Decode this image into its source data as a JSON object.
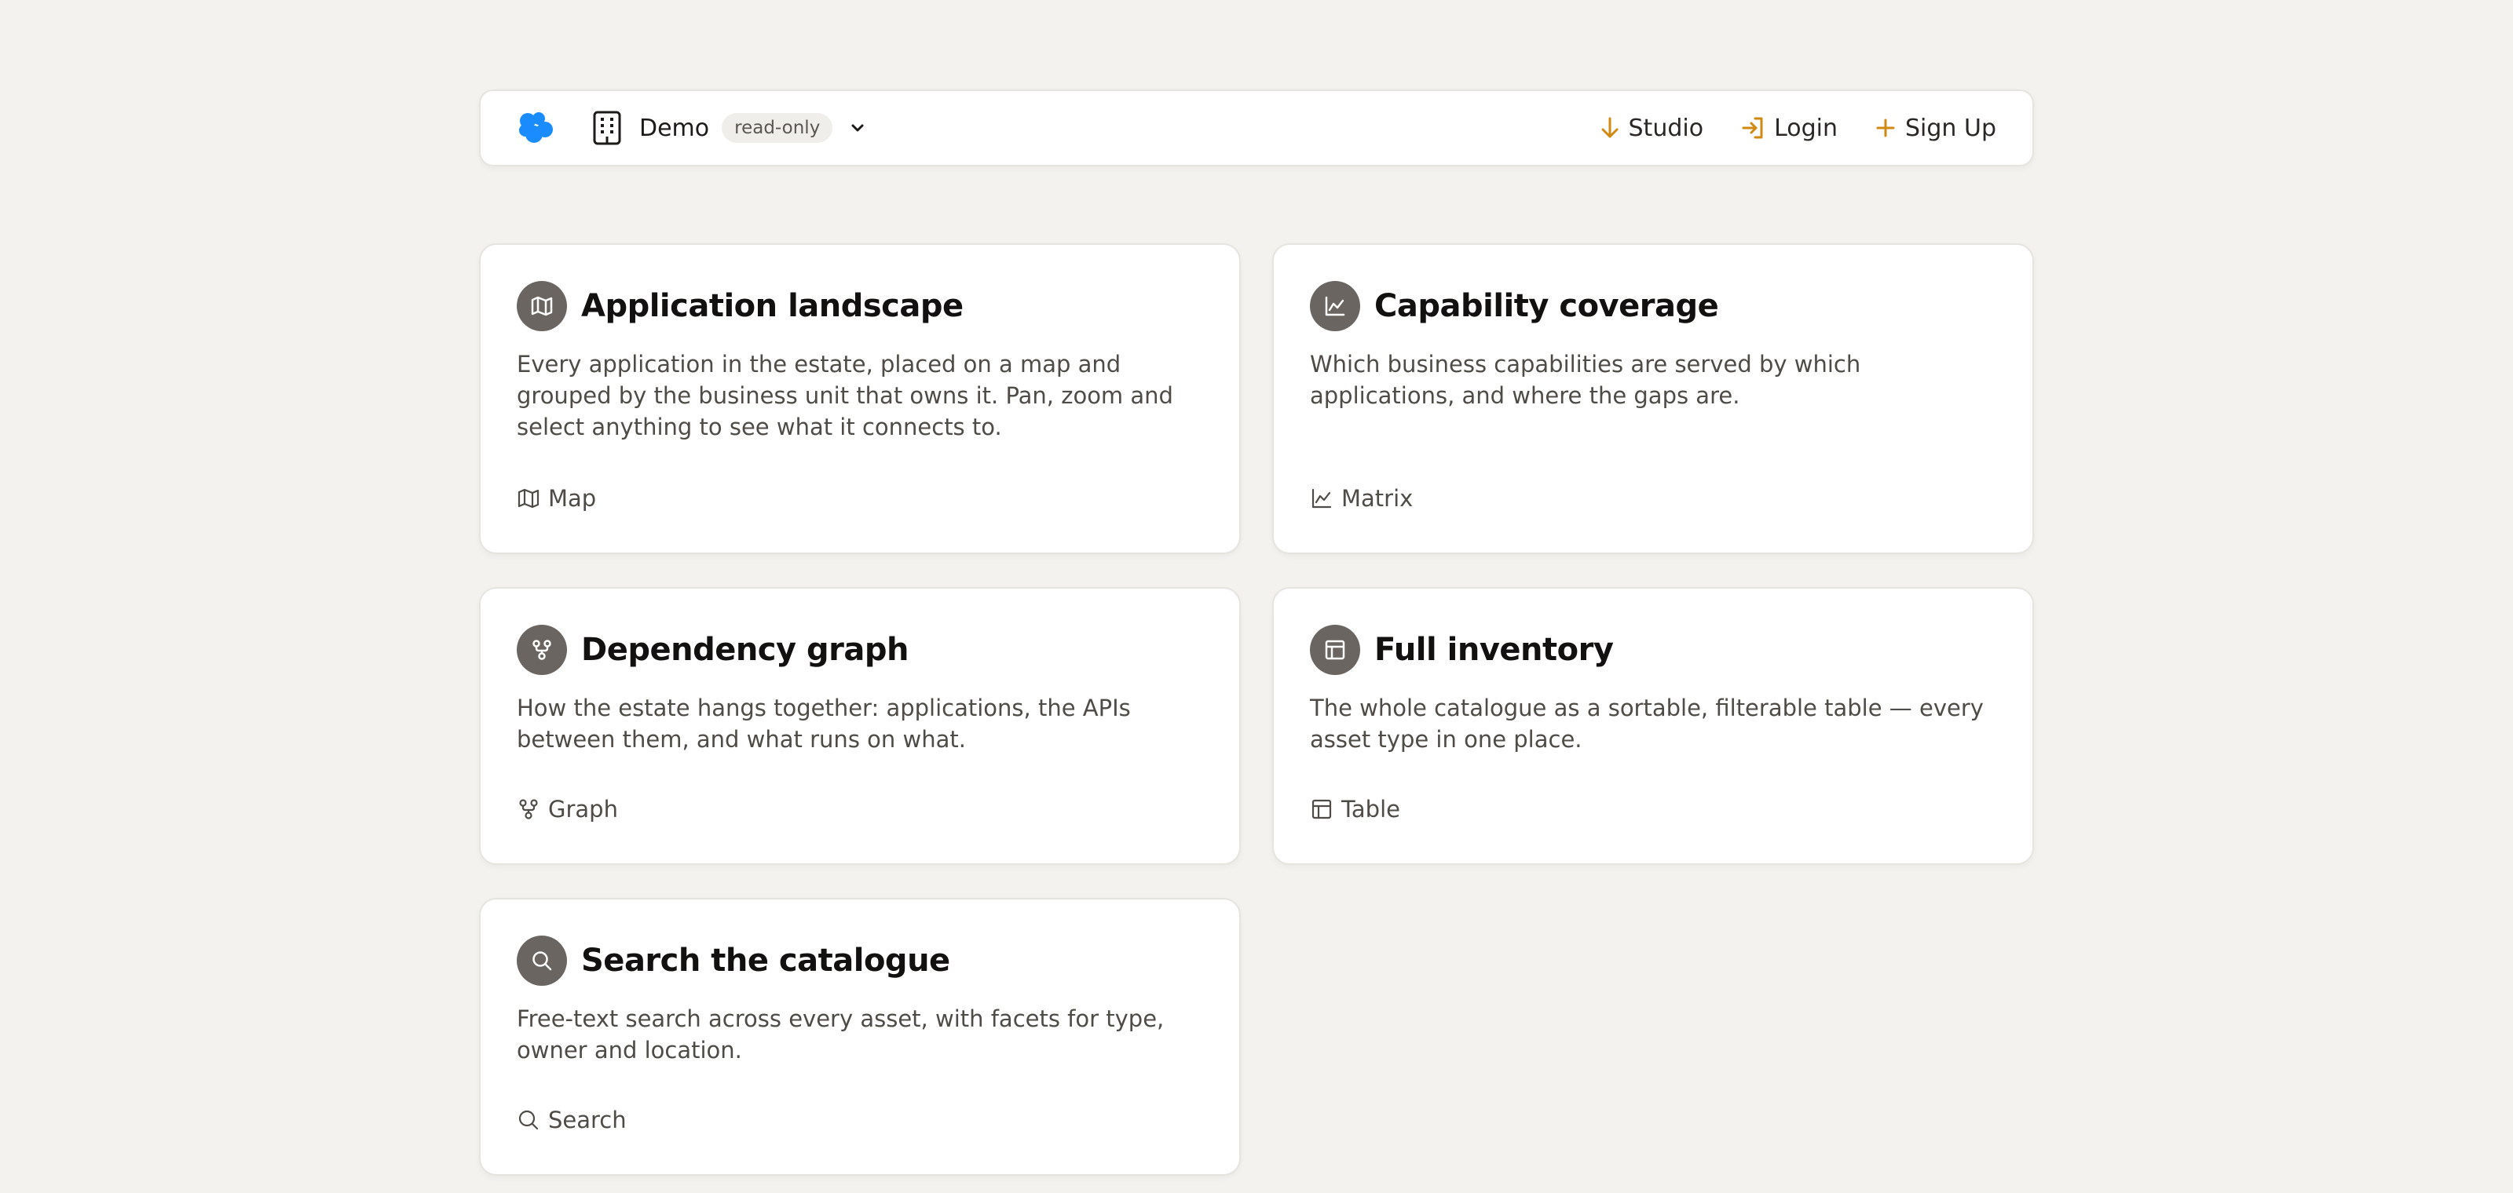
{
  "header": {
    "org_name": "Demo",
    "badge": "read-only",
    "links": [
      {
        "label": "Studio",
        "icon": "arrow-down-icon"
      },
      {
        "label": "Login",
        "icon": "login-icon"
      },
      {
        "label": "Sign Up",
        "icon": "plus-icon"
      }
    ]
  },
  "colors": {
    "logo": "#1a8cff",
    "accent": "#d08a12",
    "icon_circle": "#6a6560",
    "background": "#f3f2ef"
  },
  "cards": [
    {
      "title": "Application landscape",
      "description": "Every application in the estate, placed on a map and grouped by the business unit that owns it. Pan, zoom and select anything to see what it connects to.",
      "link": "Map",
      "icon": "map-icon"
    },
    {
      "title": "Capability coverage",
      "description": "Which business capabilities are served by which applications, and where the gaps are.",
      "link": "Matrix",
      "icon": "chart-icon"
    },
    {
      "title": "Dependency graph",
      "description": "How the estate hangs together: applications, the APIs between them, and what runs on what.",
      "link": "Graph",
      "icon": "graph-icon"
    },
    {
      "title": "Full inventory",
      "description": "The whole catalogue as a sortable, filterable table — every asset type in one place.",
      "link": "Table",
      "icon": "table-icon"
    },
    {
      "title": "Search the catalogue",
      "description": "Free-text search across every asset, with facets for type, owner and location.",
      "link": "Search",
      "icon": "search-icon"
    }
  ]
}
